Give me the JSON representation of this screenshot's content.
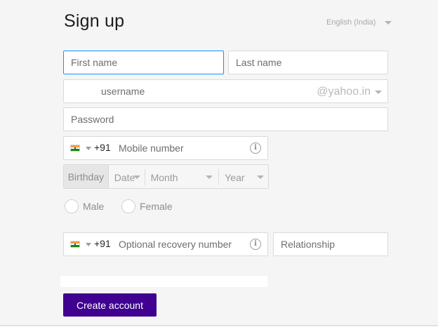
{
  "header": {
    "title": "Sign up",
    "language": "English (India)"
  },
  "form": {
    "first_name": {
      "placeholder": "First name",
      "value": ""
    },
    "last_name": {
      "placeholder": "Last name",
      "value": ""
    },
    "username": {
      "placeholder": "username",
      "value": "",
      "domain": "@yahoo.in"
    },
    "password": {
      "placeholder": "Password",
      "value": ""
    },
    "mobile": {
      "country_code": "+91",
      "placeholder": "Mobile number",
      "flag_icon": "india-flag-icon"
    },
    "birthday": {
      "label": "Birthday",
      "date": "Date",
      "month": "Month",
      "year": "Year"
    },
    "gender": {
      "male": "Male",
      "female": "Female"
    },
    "recovery": {
      "country_code": "+91",
      "placeholder": "Optional recovery number",
      "flag_icon": "india-flag-icon"
    },
    "relationship": {
      "placeholder": "Relationship"
    },
    "submit_label": "Create account"
  },
  "colors": {
    "accent": "#400090",
    "focus_border": "#188fff",
    "background": "#f5f5f5"
  }
}
